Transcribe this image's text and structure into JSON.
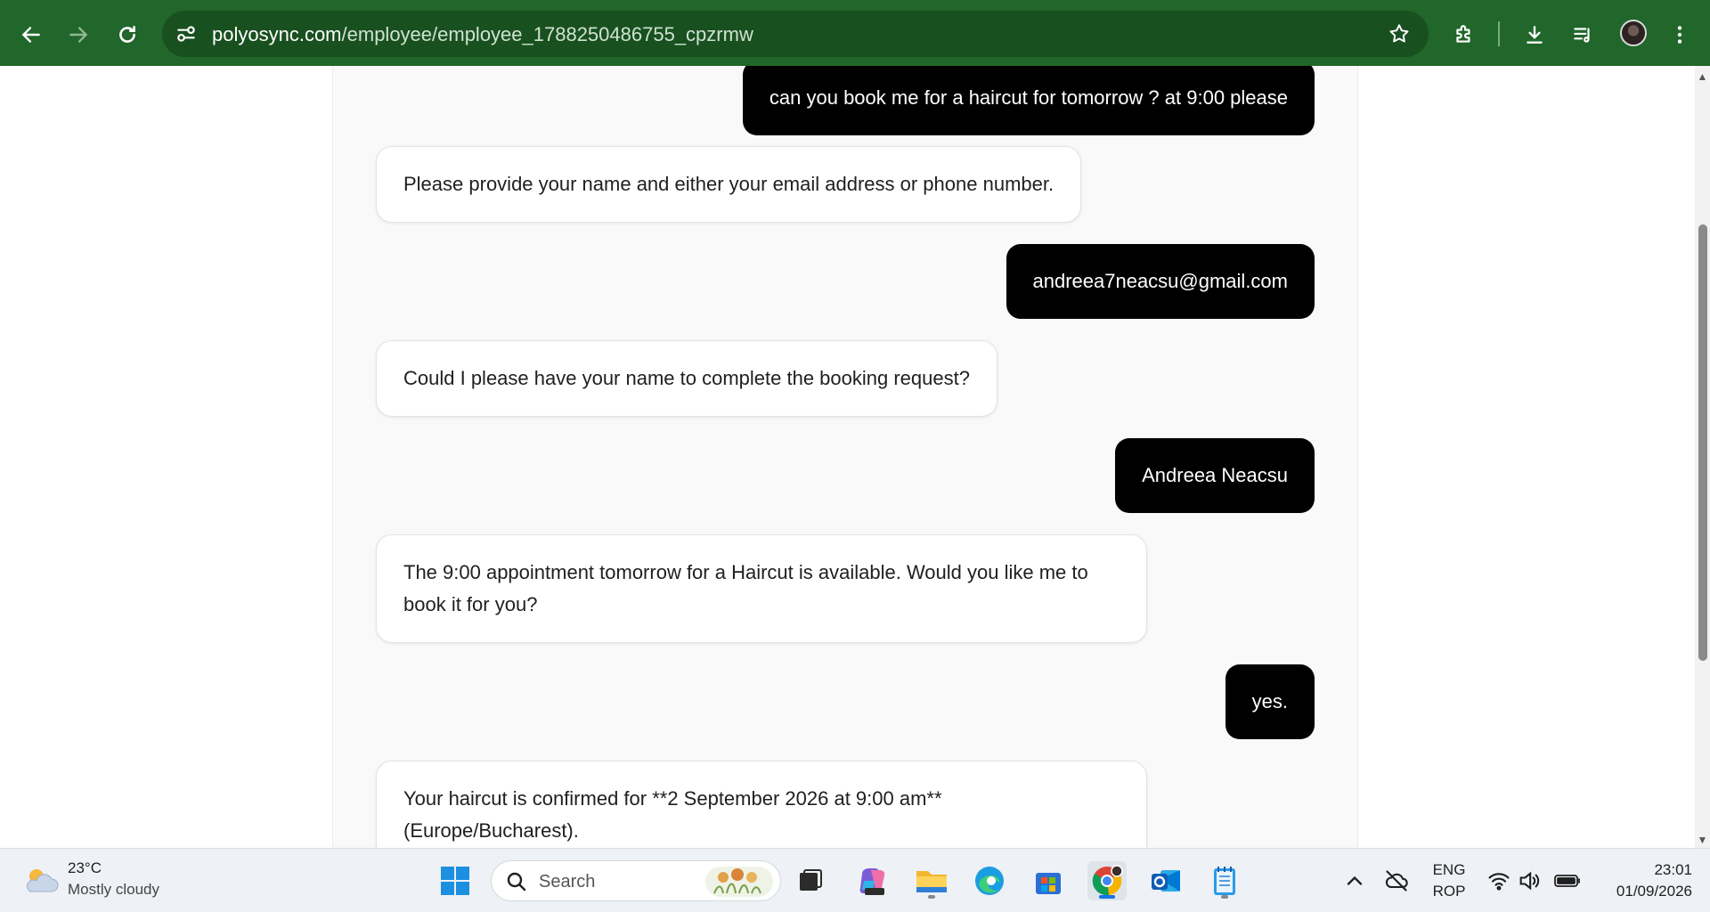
{
  "browser": {
    "url_domain": "polyosync.com",
    "url_path": "/employee/employee_1788250486755_cpzrmw"
  },
  "chat": {
    "messages": [
      {
        "role": "user",
        "text": "can you book me for a haircut for tomorrow ? at 9:00 please"
      },
      {
        "role": "bot",
        "text": "Please provide your name and either your email address or phone number."
      },
      {
        "role": "user",
        "text": "andreea7neacsu@gmail.com"
      },
      {
        "role": "bot",
        "text": "Could I please have your name to complete the booking request?"
      },
      {
        "role": "user",
        "text": "Andreea Neacsu"
      },
      {
        "role": "bot",
        "text": "The 9:00 appointment tomorrow for a Haircut is available. Would you like me to book it for you?"
      },
      {
        "role": "user",
        "text": "yes."
      },
      {
        "role": "bot",
        "text": "Your haircut is confirmed for **2 September 2026 at 9:00 am** (Europe/Bucharest)."
      }
    ]
  },
  "taskbar": {
    "weather": {
      "temp": "23°C",
      "desc": "Mostly cloudy"
    },
    "search_placeholder": "Search",
    "lang_top": "ENG",
    "lang_bottom": "ROP",
    "time": "23:01",
    "date": "01/09/2026"
  },
  "colors": {
    "toolbar": "#21662a",
    "omnibox": "#195020",
    "user_bubble": "#000000",
    "bot_bubble": "#ffffff"
  }
}
